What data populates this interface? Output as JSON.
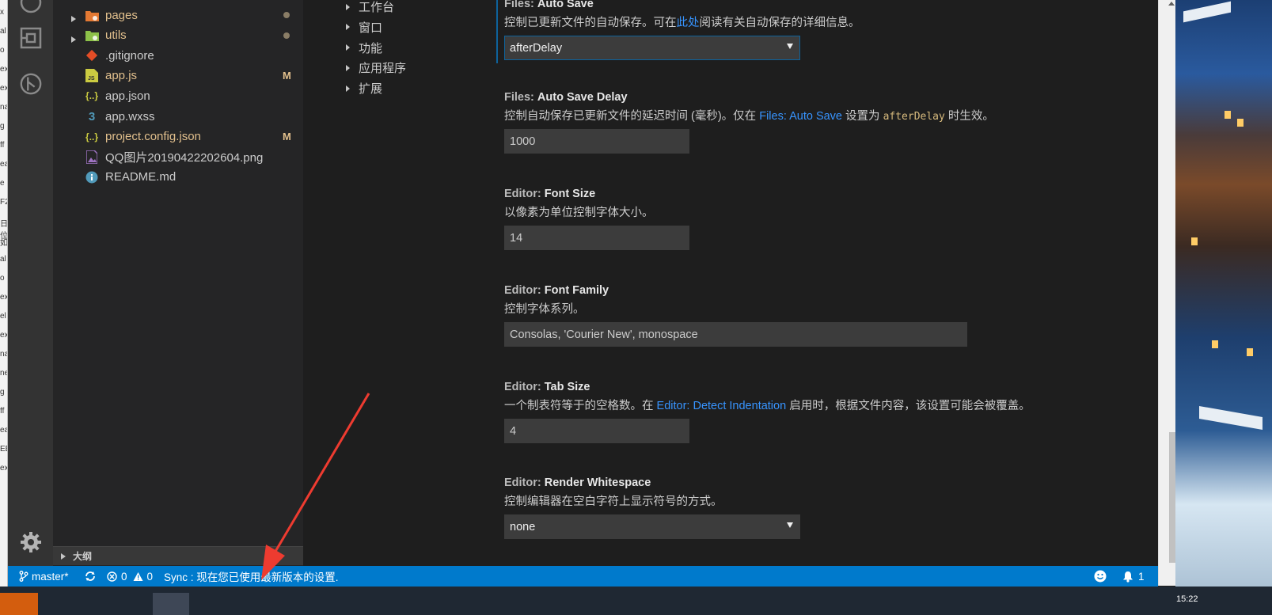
{
  "left_window": {
    "fragments": [
      "x",
      "al",
      "o",
      "ex",
      "ex",
      "na",
      "g",
      "ff",
      "ea",
      "e",
      "F2",
      "日位",
      "如",
      "al",
      "o",
      "ex",
      "el",
      "ex",
      "na",
      "ne",
      "g",
      "ff",
      "ea",
      "EB",
      "ex"
    ]
  },
  "activity_bar": {
    "icons": [
      "search-icon",
      "extensions-icon",
      "git-graph-icon",
      "settings-gear-icon"
    ]
  },
  "explorer": {
    "items": [
      {
        "name": "pages",
        "kind": "folder",
        "expandable": true,
        "status": "dot",
        "icon_color": "#e37933"
      },
      {
        "name": "utils",
        "kind": "folder",
        "expandable": true,
        "status": "dot",
        "icon_color": "#8dc149"
      },
      {
        "name": ".gitignore",
        "kind": "file",
        "status": "",
        "icon_color": "#e44d26"
      },
      {
        "name": "app.js",
        "kind": "file",
        "status": "M",
        "icon_color": "#cbcb41",
        "icon_text": "JS",
        "modified": true
      },
      {
        "name": "app.json",
        "kind": "file",
        "status": "",
        "icon_color": "#cbcb41",
        "icon_text": "{..}"
      },
      {
        "name": "app.wxss",
        "kind": "file",
        "status": "",
        "icon_color": "#519aba",
        "icon_text": "3"
      },
      {
        "name": "project.config.json",
        "kind": "file",
        "status": "M",
        "icon_color": "#cbcb41",
        "icon_text": "{..}",
        "modified": true
      },
      {
        "name": "QQ图片20190422202604.png",
        "kind": "file",
        "status": "",
        "icon_color": "#a074c4"
      },
      {
        "name": "README.md",
        "kind": "file",
        "status": "",
        "icon_color": "#519aba",
        "icon_text": "i"
      }
    ],
    "outline_label": "大纲"
  },
  "settings_toc": {
    "items": [
      "工作台",
      "窗口",
      "功能",
      "应用程序",
      "扩展"
    ]
  },
  "settings": {
    "auto_save": {
      "category": "Files:",
      "name": "Auto Save",
      "desc_before": "控制已更新文件的自动保存。可在",
      "desc_link": "此处",
      "desc_after": "阅读有关自动保存的详细信息。",
      "value": "afterDelay"
    },
    "auto_save_delay": {
      "category": "Files:",
      "name": "Auto Save Delay",
      "desc_before": "控制自动保存已更新文件的延迟时间 (毫秒)。仅在 ",
      "desc_link": "Files: Auto Save",
      "desc_mid": " 设置为 ",
      "desc_code": "afterDelay",
      "desc_after": " 时生效。",
      "value": "1000"
    },
    "font_size": {
      "category": "Editor:",
      "name": "Font Size",
      "desc": "以像素为单位控制字体大小。",
      "value": "14"
    },
    "font_family": {
      "category": "Editor:",
      "name": "Font Family",
      "desc": "控制字体系列。",
      "value": "Consolas, 'Courier New', monospace"
    },
    "tab_size": {
      "category": "Editor:",
      "name": "Tab Size",
      "desc_before": "一个制表符等于的空格数。在 ",
      "desc_link": "Editor: Detect Indentation",
      "desc_after": " 启用时，根据文件内容，该设置可能会被覆盖。",
      "value": "4"
    },
    "render_whitespace": {
      "category": "Editor:",
      "name": "Render Whitespace",
      "desc": "控制编辑器在空白字符上显示符号的方式。",
      "value": "none"
    }
  },
  "status_bar": {
    "branch": "master*",
    "errors": "0",
    "warnings": "0",
    "sync_message": "Sync : 现在您已使用最新版本的设置.",
    "notifications": "1"
  },
  "taskbar": {
    "clock": "15:22"
  },
  "colors": {
    "accent": "#007acc",
    "link": "#3794ff",
    "modified": "#e2c08d",
    "annotation_arrow": "#ee3b30"
  }
}
